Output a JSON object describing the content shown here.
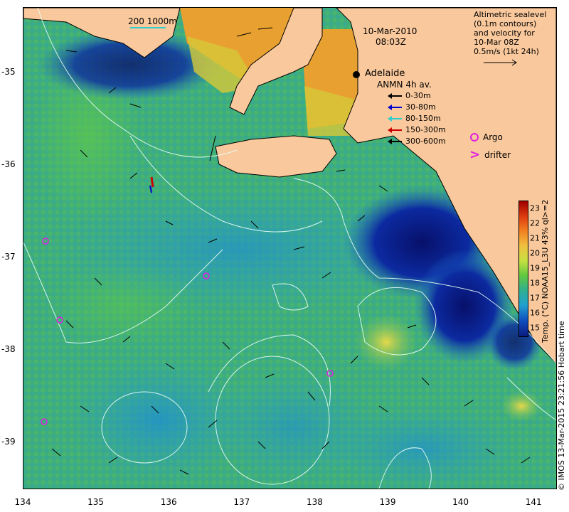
{
  "map": {
    "date": "10-Mar-2010",
    "time": "08:03Z",
    "scale_bar_label": "200  1000m",
    "place_label": "Adelaide",
    "altimetry_note": [
      "Altimetric sealevel",
      "(0.1m contours)",
      "and velocity for",
      "10-Mar 08Z",
      "0.5m/s (1kt 24h)"
    ],
    "mooring_title": "ANMN 4h av.",
    "mooring_depths": [
      {
        "label": "0-30m",
        "color": "#000000"
      },
      {
        "label": "30-80m",
        "color": "#0000cc"
      },
      {
        "label": "80-150m",
        "color": "#33cccc"
      },
      {
        "label": "150-300m",
        "color": "#cc0000"
      },
      {
        "label": "300-600m",
        "color": "#000000"
      }
    ],
    "argo_label": "Argo",
    "drifter_label": "drifter",
    "colorbar_title": "Temp. (°C) NOAA15_L3U 43% ql>=2",
    "colorbar_ticks": [
      "23",
      "22",
      "21",
      "20",
      "19",
      "18",
      "17",
      "16",
      "15"
    ],
    "colorbar_range": [
      14.5,
      23.5
    ],
    "credit": "© IMOS 13-Mar-2015 23:21:56 Hobart time",
    "x_ticks": [
      "134",
      "135",
      "136",
      "137",
      "138",
      "139",
      "140",
      "141"
    ],
    "y_ticks": [
      "-35",
      "-36",
      "-37",
      "-38",
      "-39"
    ],
    "lon_range": [
      134,
      141.3
    ],
    "lat_range": [
      -39.5,
      -34.3
    ],
    "argo_floats": [
      [
        134.3,
        -36.82
      ],
      [
        134.5,
        -37.68
      ],
      [
        136.5,
        -37.2
      ],
      [
        138.2,
        -38.25
      ],
      [
        134.28,
        -38.78
      ]
    ],
    "colors": {
      "land": "#f9c89c",
      "ocean_cool": "#0a1a8a",
      "ocean_mid": "#2aa0c8",
      "ocean_warm": "#3cb878",
      "argo": "#e020e0",
      "contour": "#e6fff6"
    }
  }
}
